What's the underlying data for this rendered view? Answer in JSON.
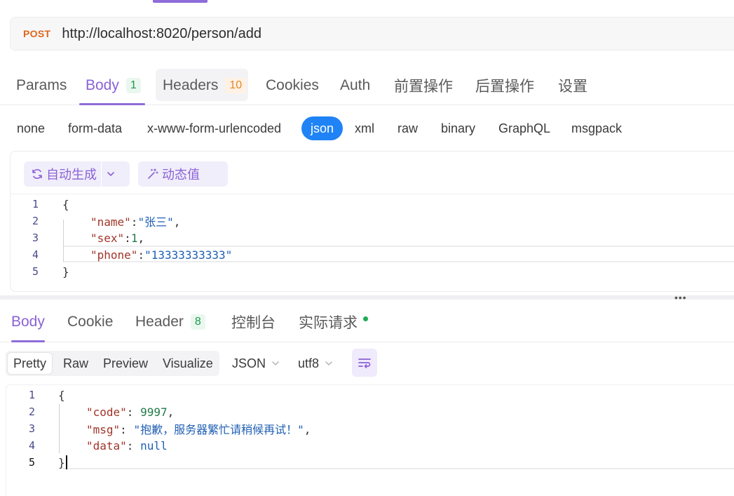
{
  "request": {
    "method": "POST",
    "url": "http://localhost:8020/person/add"
  },
  "request_tabs": {
    "params": "Params",
    "body": "Body",
    "body_count": "1",
    "headers": "Headers",
    "headers_count": "10",
    "cookies": "Cookies",
    "auth": "Auth",
    "pre_ops": "前置操作",
    "post_ops": "后置操作",
    "settings": "设置"
  },
  "body_types": [
    "none",
    "form-data",
    "x-www-form-urlencoded",
    "json",
    "xml",
    "raw",
    "binary",
    "GraphQL",
    "msgpack"
  ],
  "editor_toolbar": {
    "auto_generate": "自动生成",
    "dynamic_value": "动态值"
  },
  "request_body": {
    "line_numbers": [
      "1",
      "2",
      "3",
      "4",
      "5"
    ],
    "open": "{",
    "name_key": "\"name\"",
    "name_val": "\"张三\"",
    "sex_key": "\"sex\"",
    "sex_val": "1",
    "phone_key": "\"phone\"",
    "phone_val": "\"13333333333\"",
    "close": "}"
  },
  "response_tabs": {
    "body": "Body",
    "cookie": "Cookie",
    "header": "Header",
    "header_count": "8",
    "console": "控制台",
    "actual_request": "实际请求"
  },
  "view_modes": [
    "Pretty",
    "Raw",
    "Preview",
    "Visualize"
  ],
  "format_select": "JSON",
  "encoding_select": "utf8",
  "response_body": {
    "line_numbers": [
      "1",
      "2",
      "3",
      "4",
      "5"
    ],
    "open": "{",
    "code_key": "\"code\"",
    "code_val": "9997",
    "msg_key": "\"msg\"",
    "msg_val": "\"抱歉，服务器繁忙请稍候再试！\"",
    "data_key": "\"data\"",
    "data_val": "null",
    "close": "}"
  },
  "colors": {
    "accent": "#8e6cd9",
    "method": "#e0651d",
    "json_active": "#1f83f5"
  }
}
